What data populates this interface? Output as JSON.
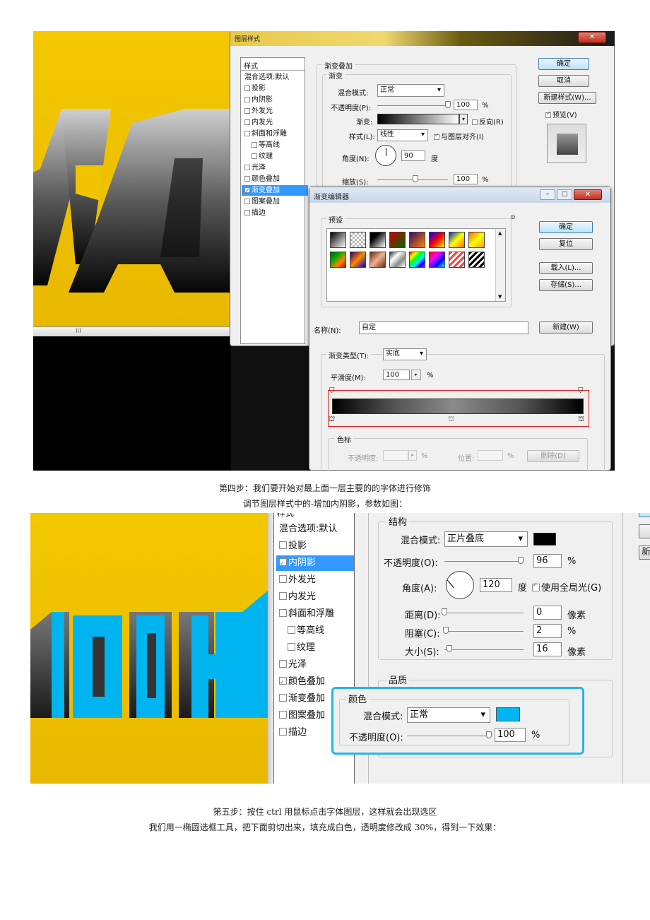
{
  "screenshot1": {
    "layer_style_dialog": {
      "title": "图层样式",
      "list_header": "样式",
      "list_items": [
        {
          "label": "混合选项:默认",
          "checkbox": false,
          "checked": false,
          "selected": false
        },
        {
          "label": "投影",
          "checkbox": true,
          "checked": false,
          "selected": false
        },
        {
          "label": "内阴影",
          "checkbox": true,
          "checked": false,
          "selected": false
        },
        {
          "label": "外发光",
          "checkbox": true,
          "checked": false,
          "selected": false
        },
        {
          "label": "内发光",
          "checkbox": true,
          "checked": false,
          "selected": false
        },
        {
          "label": "斜面和浮雕",
          "checkbox": true,
          "checked": false,
          "selected": false
        },
        {
          "label": "等高线",
          "checkbox": true,
          "checked": false,
          "selected": false
        },
        {
          "label": "纹理",
          "checkbox": true,
          "checked": false,
          "selected": false
        },
        {
          "label": "光泽",
          "checkbox": true,
          "checked": false,
          "selected": false
        },
        {
          "label": "颜色叠加",
          "checkbox": true,
          "checked": false,
          "selected": false
        },
        {
          "label": "渐变叠加",
          "checkbox": true,
          "checked": true,
          "selected": true
        },
        {
          "label": "图案叠加",
          "checkbox": true,
          "checked": false,
          "selected": false
        },
        {
          "label": "描边",
          "checkbox": true,
          "checked": false,
          "selected": false
        }
      ],
      "section_title": "渐变叠加",
      "sub_title": "渐变",
      "blend_mode_label": "混合模式:",
      "blend_mode_value": "正常",
      "opacity_label": "不透明度(P):",
      "opacity_value": "100",
      "opacity_unit": "%",
      "opacity_level": 1.0,
      "gradient_label": "渐变:",
      "reverse_label": "反向(R)",
      "style_label": "样式(L):",
      "style_value": "线性",
      "align_label": "与图层对齐(I)",
      "angle_label": "角度(N):",
      "angle_value": "90",
      "angle_unit": "度",
      "scale_label": "缩放(S):",
      "scale_value": "100",
      "scale_unit": "%",
      "ok": "确定",
      "cancel": "取消",
      "new_style": "新建样式(W)...",
      "preview": "预览(V)",
      "close_icon": "close-icon"
    },
    "gradient_editor": {
      "title": "渐变编辑器",
      "presets_label": "预设",
      "ok": "确定",
      "reset": "复位",
      "load": "载入(L)...",
      "save": "存储(S)...",
      "name_label": "名称(N):",
      "name_value": "自定",
      "new": "新建(W)",
      "type_label": "渐变类型(T):",
      "type_value": "实底",
      "smooth_label": "平滑度(M):",
      "smooth_value": "100",
      "smooth_unit": "%",
      "stops_label": "色标",
      "stop_opacity_label": "不透明度:",
      "stop_opacity_unit": "%",
      "stop_position_label": "位置:",
      "stop_position_unit": "%",
      "delete": "删除(D)",
      "presets": [
        "#000-#fff",
        "checker",
        "#000-#fff-r",
        "red-green",
        "purple-orange",
        "rainbow1",
        "blue-yellow",
        "orange-yellow",
        "green-rainbow",
        "violet-orange",
        "copper",
        "chrome",
        "spectrum",
        "rainbow2",
        "transparent-stripes",
        "bw-stripes"
      ]
    },
    "scrollbar_text": "III"
  },
  "caption1": "第四步：我们要开始对最上面一层主要的的字体进行修饰",
  "caption2": "调节图层样式中的-增加内阴影，参数如图：",
  "screenshot2": {
    "list_top": "样式",
    "list_items": [
      {
        "label": "混合选项:默认",
        "checkbox": false,
        "checked": false,
        "selected": false
      },
      {
        "label": "投影",
        "checkbox": true,
        "checked": false,
        "selected": false
      },
      {
        "label": "内阴影",
        "checkbox": true,
        "checked": true,
        "selected": true
      },
      {
        "label": "外发光",
        "checkbox": true,
        "checked": false,
        "selected": false
      },
      {
        "label": "内发光",
        "checkbox": true,
        "checked": false,
        "selected": false
      },
      {
        "label": "斜面和浮雕",
        "checkbox": true,
        "checked": false,
        "selected": false
      },
      {
        "label": "等高线",
        "checkbox": true,
        "checked": false,
        "selected": false
      },
      {
        "label": "纹理",
        "checkbox": true,
        "checked": false,
        "selected": false
      },
      {
        "label": "光泽",
        "checkbox": true,
        "checked": false,
        "selected": false
      },
      {
        "label": "颜色叠加",
        "checkbox": true,
        "checked": true,
        "selected": false
      },
      {
        "label": "渐变叠加",
        "checkbox": true,
        "checked": false,
        "selected": false
      },
      {
        "label": "图案叠加",
        "checkbox": true,
        "checked": false,
        "selected": false
      },
      {
        "label": "描边",
        "checkbox": true,
        "checked": false,
        "selected": false
      }
    ],
    "structure_title": "结构",
    "blend_mode_label": "混合模式:",
    "blend_mode_value": "正片叠底",
    "blend_color": "#000000",
    "opacity_label": "不透明度(O):",
    "opacity_value": "96",
    "opacity_unit": "%",
    "opacity_level": 0.96,
    "angle_label": "角度(A):",
    "angle_value": "120",
    "angle_unit": "度",
    "global_light_label": "使用全局光(G)",
    "distance_label": "距离(D):",
    "distance_value": "0",
    "distance_unit": "像素",
    "distance_level": 0,
    "choke_label": "阻塞(C):",
    "choke_value": "2",
    "choke_unit": "%",
    "choke_level": 0.02,
    "size_label": "大小(S):",
    "size_value": "16",
    "size_unit": "像素",
    "size_level": 0.064,
    "quality_title": "品质",
    "color_section_title": "颜色",
    "color_blend_label": "混合模式:",
    "color_blend_value": "正常",
    "color_swatch": "#00b4f0",
    "color_opacity_label": "不透明度(O):",
    "color_opacity_value": "100",
    "color_opacity_unit": "%",
    "color_opacity_level": 1.0,
    "new_btn_partial": "新",
    "highlight_color": "#28b4e6"
  },
  "caption3": "第五步：按住 ctrl 用鼠标点击字体图层，这样就会出现选区",
  "caption4": "我们用一椭圆选框工具，把下面剪切出来，填充成白色，透明度修改成 30%，得到一下效果："
}
